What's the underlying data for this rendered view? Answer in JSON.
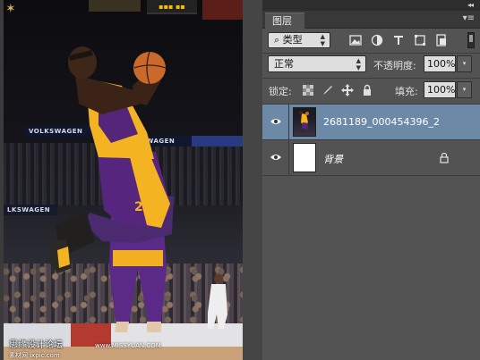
{
  "panel": {
    "collapse_icon": "◂◂",
    "tab_label": "图层",
    "menu_icon": "▾≡",
    "filter": {
      "label": "类型",
      "search_icon": "⌕"
    },
    "blend_mode": "正常",
    "opacity_label": "不透明度:",
    "opacity_value": "100%",
    "lock_label": "锁定:",
    "fill_label": "填充:",
    "fill_value": "100%",
    "dropdown_arrow": "▾",
    "layers": [
      {
        "name": "2681189_000454396_2",
        "selected": true,
        "visible": true,
        "locked": false,
        "thumbnail": "photo"
      },
      {
        "name": "背景",
        "selected": false,
        "visible": true,
        "locked": true,
        "thumbnail": "white",
        "italic": true
      }
    ]
  },
  "canvas": {
    "banner_1": "VOLKSWAGEN",
    "banner_2": "SWAGEN",
    "banner_3": "LKSWAGEN",
    "watermark": "思缘设计论坛",
    "watermark_url": "www.MISSYUAN.COM",
    "watermark_small": "素材网 ixpic.com"
  },
  "colors": {
    "panel_bg": "#535353",
    "selected_layer": "#6c8aa8",
    "lakers_purple": "#55257a",
    "lakers_gold": "#f4b320"
  }
}
